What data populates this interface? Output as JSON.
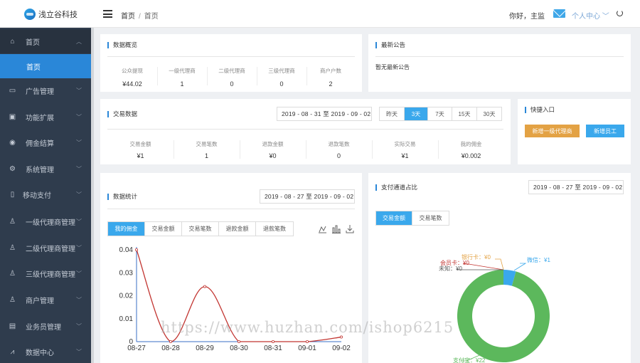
{
  "header": {
    "logo_text": "浅立谷科技",
    "breadcrumb_home": "首页",
    "breadcrumb_sep": "/",
    "breadcrumb_current": "首页",
    "greeting": "你好，主监",
    "profile_label": "个人中心 ﹀"
  },
  "sidebar": {
    "items": [
      {
        "label": "首页",
        "icon": "home-icon"
      },
      {
        "label": "首页",
        "icon": ""
      },
      {
        "label": "广告管理",
        "icon": "ad-icon"
      },
      {
        "label": "功能扩展",
        "icon": "box-icon"
      },
      {
        "label": "佣金结算",
        "icon": "coin-icon"
      },
      {
        "label": "系统管理",
        "icon": "gear-icon"
      },
      {
        "label": "移动支付",
        "icon": "phone-icon"
      },
      {
        "label": "一级代理商管理",
        "icon": "user-icon"
      },
      {
        "label": "二级代理商管理",
        "icon": "user-icon"
      },
      {
        "label": "三级代理商管理",
        "icon": "user-icon"
      },
      {
        "label": "商户管理",
        "icon": "user-icon"
      },
      {
        "label": "业务员管理",
        "icon": "briefcase-icon"
      },
      {
        "label": "数据中心",
        "icon": "chart-icon"
      }
    ]
  },
  "overview": {
    "title": "数据概览",
    "stats": [
      {
        "label": "公众提现",
        "value": "¥44.02"
      },
      {
        "label": "一级代理商",
        "value": "1"
      },
      {
        "label": "二级代理商",
        "value": "0"
      },
      {
        "label": "三级代理商",
        "value": "0"
      },
      {
        "label": "商户户数",
        "value": "2"
      }
    ]
  },
  "notice": {
    "title": "最新公告",
    "text": "暂无最新公告"
  },
  "trade": {
    "title": "交易数据",
    "date_range": "2019 - 08 - 31 至 2019 - 09 - 02",
    "ranges": [
      "昨天",
      "3天",
      "7天",
      "15天",
      "30天"
    ],
    "active_range": "3天",
    "stats": [
      {
        "label": "交易金额",
        "value": "¥1"
      },
      {
        "label": "交易笔数",
        "value": "1"
      },
      {
        "label": "退款金额",
        "value": "¥0"
      },
      {
        "label": "退款笔数",
        "value": "0"
      },
      {
        "label": "实际交易",
        "value": "¥1"
      },
      {
        "label": "我的佣金",
        "value": "¥0.002"
      }
    ]
  },
  "quick": {
    "title": "快捷入口",
    "btn_agent": "新增一级代理商",
    "btn_staff": "新增员工",
    "color_agent": "#e3a244",
    "color_staff": "#3aa8ec"
  },
  "stats_panel": {
    "title": "数据统计",
    "date_range": "2019 - 08 - 27 至 2019 - 09 - 02",
    "tabs": [
      "我的佣金",
      "交易金额",
      "交易笔数",
      "退款金额",
      "退款笔数"
    ],
    "active_tab": "我的佣金"
  },
  "channel_panel": {
    "title": "支付通道占比",
    "date_range": "2019 - 08 - 27 至 2019 - 09 - 02",
    "tabs": [
      "交易金额",
      "交易笔数"
    ],
    "active_tab": "交易金额"
  },
  "chart_data": [
    {
      "type": "line",
      "x": [
        "08-27",
        "08-28",
        "08-29",
        "08-30",
        "08-31",
        "09-01",
        "09-02"
      ],
      "series": [
        {
          "values": [
            0.04,
            0,
            0.024,
            0,
            0,
            0,
            0.002
          ],
          "color": "#c23531"
        }
      ],
      "yticks": [
        "0",
        "0.01",
        "0.02",
        "0.03",
        "0.04"
      ],
      "ylim": [
        0,
        0.04
      ]
    },
    {
      "type": "pie",
      "slices": [
        {
          "label": "支付宝：¥22",
          "value": 22,
          "color": "#5cb85c"
        },
        {
          "label": "微信：¥1",
          "value": 1,
          "color": "#3aa8ec"
        },
        {
          "label": "银行卡：¥0",
          "value": 0,
          "color": "#e3a244"
        },
        {
          "label": "会员卡：¥0",
          "value": 0,
          "color": "#c23531"
        },
        {
          "label": "未知：¥0",
          "value": 0,
          "color": "#555555"
        }
      ]
    }
  ],
  "watermark": "https://www.huzhan.com/ishop6215"
}
